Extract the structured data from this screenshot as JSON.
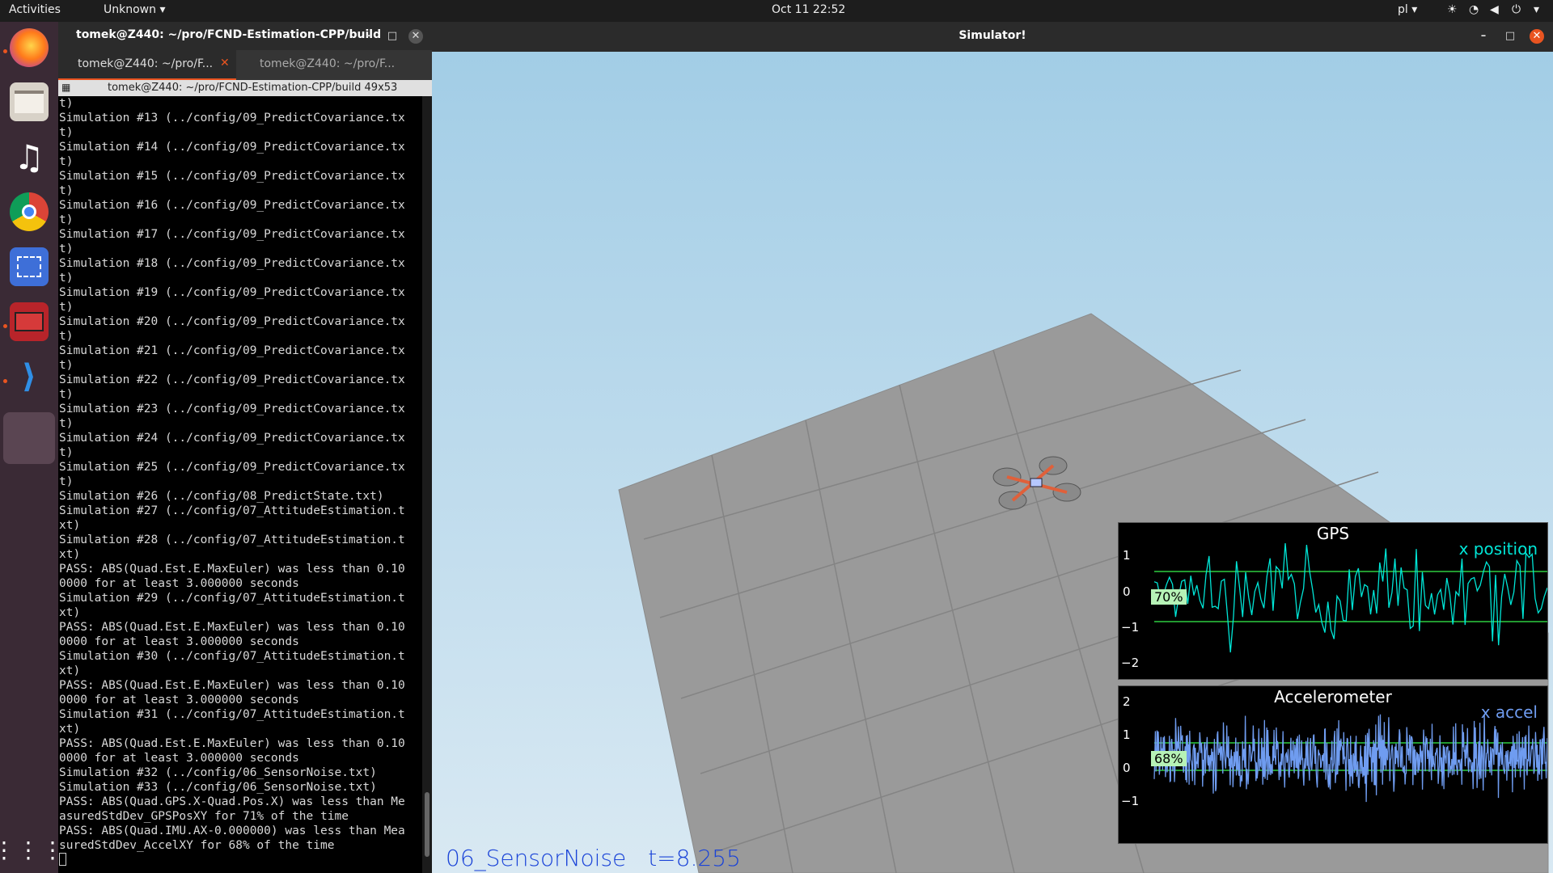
{
  "topbar": {
    "activities": "Activities",
    "app_menu": "Unknown",
    "clock": "Oct 11  22:52",
    "input_lang": "pl"
  },
  "dock": {
    "apps": [
      "Firefox",
      "Files",
      "Rhythmbox",
      "Google Chrome",
      "Screenshot",
      "Terminal",
      "Visual Studio Code",
      "Simulator"
    ]
  },
  "terminal": {
    "window_title": "tomek@Z440: ~/pro/FCND-Estimation-CPP/build",
    "tabs": [
      "tomek@Z440: ~/pro/F...",
      "tomek@Z440: ~/pro/F..."
    ],
    "header": "tomek@Z440: ~/pro/FCND-Estimation-CPP/build 49x53",
    "lines": [
      "t)",
      "Simulation #13 (../config/09_PredictCovariance.tx",
      "t)",
      "Simulation #14 (../config/09_PredictCovariance.tx",
      "t)",
      "Simulation #15 (../config/09_PredictCovariance.tx",
      "t)",
      "Simulation #16 (../config/09_PredictCovariance.tx",
      "t)",
      "Simulation #17 (../config/09_PredictCovariance.tx",
      "t)",
      "Simulation #18 (../config/09_PredictCovariance.tx",
      "t)",
      "Simulation #19 (../config/09_PredictCovariance.tx",
      "t)",
      "Simulation #20 (../config/09_PredictCovariance.tx",
      "t)",
      "Simulation #21 (../config/09_PredictCovariance.tx",
      "t)",
      "Simulation #22 (../config/09_PredictCovariance.tx",
      "t)",
      "Simulation #23 (../config/09_PredictCovariance.tx",
      "t)",
      "Simulation #24 (../config/09_PredictCovariance.tx",
      "t)",
      "Simulation #25 (../config/09_PredictCovariance.tx",
      "t)",
      "Simulation #26 (../config/08_PredictState.txt)",
      "Simulation #27 (../config/07_AttitudeEstimation.t",
      "xt)",
      "Simulation #28 (../config/07_AttitudeEstimation.t",
      "xt)",
      "PASS: ABS(Quad.Est.E.MaxEuler) was less than 0.10",
      "0000 for at least 3.000000 seconds",
      "Simulation #29 (../config/07_AttitudeEstimation.t",
      "xt)",
      "PASS: ABS(Quad.Est.E.MaxEuler) was less than 0.10",
      "0000 for at least 3.000000 seconds",
      "Simulation #30 (../config/07_AttitudeEstimation.t",
      "xt)",
      "PASS: ABS(Quad.Est.E.MaxEuler) was less than 0.10",
      "0000 for at least 3.000000 seconds",
      "Simulation #31 (../config/07_AttitudeEstimation.t",
      "xt)",
      "PASS: ABS(Quad.Est.E.MaxEuler) was less than 0.10",
      "0000 for at least 3.000000 seconds",
      "Simulation #32 (../config/06_SensorNoise.txt)",
      "Simulation #33 (../config/06_SensorNoise.txt)",
      "PASS: ABS(Quad.GPS.X-Quad.Pos.X) was less than Me",
      "asuredStdDev_GPSPosXY for 71% of the time",
      "PASS: ABS(Quad.IMU.AX-0.000000) was less than Mea",
      "suredStdDev_AccelXY for 68% of the time"
    ]
  },
  "simulator": {
    "window_title": "Simulator!",
    "scenario_label": "06_SensorNoise",
    "time_label": "t=8.255",
    "plots": [
      {
        "title": "GPS",
        "series": "x position",
        "percent": "70%",
        "ticks": [
          "1",
          "0",
          "−1",
          "−2"
        ]
      },
      {
        "title": "Accelerometer",
        "series": "x accel",
        "percent": "68%",
        "ticks": [
          "2",
          "1",
          "0",
          "−1"
        ]
      }
    ]
  },
  "colors": {
    "gps_line": "#00e5d6",
    "accel_line": "#6f9cf0",
    "threshold": "#2ecc40",
    "label": "#1b44d8"
  }
}
